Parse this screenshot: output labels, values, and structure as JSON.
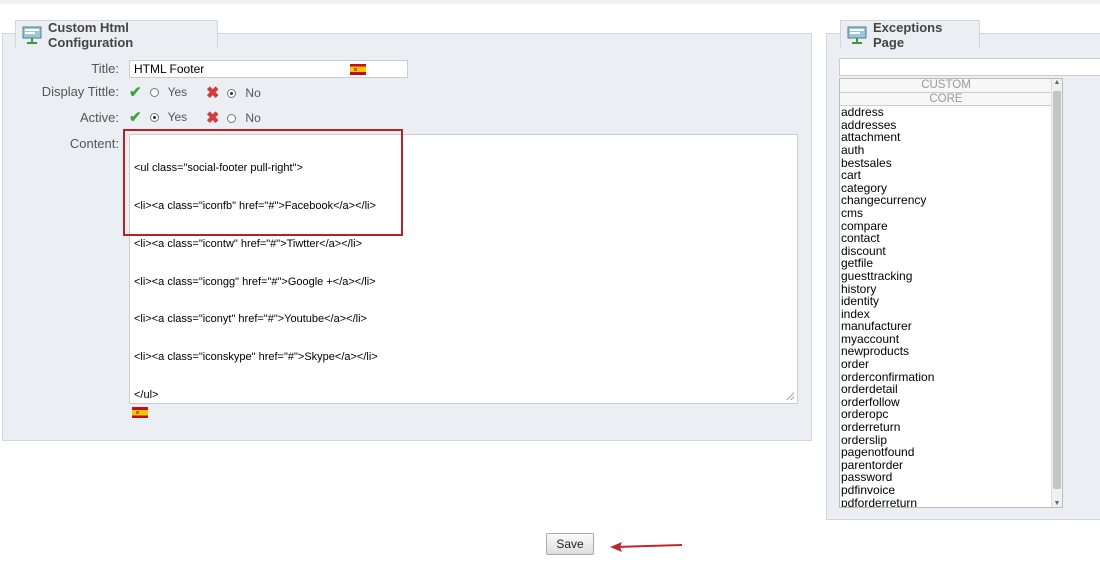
{
  "left_panel": {
    "legend": "Custom Html Configuration",
    "title_label": "Title:",
    "title_value": "HTML Footer",
    "display_title_label": "Display Tittle:",
    "display_title_yes": "Yes",
    "display_title_no": "No",
    "display_title_selected": "No",
    "active_label": "Active:",
    "active_yes": "Yes",
    "active_no": "No",
    "active_selected": "Yes",
    "content_label": "Content:",
    "content_lines": [
      "<ul class=\"social-footer pull-right\">",
      "<li><a class=\"iconfb\" href=\"#\">Facebook</a></li>",
      "<li><a class=\"icontw\" href=\"#\">Tiwtter</a></li>",
      "<li><a class=\"icongg\" href=\"#\">Google +</a></li>",
      "<li><a class=\"iconyt\" href=\"#\">Youtube</a></li>",
      "<li><a class=\"iconskype\" href=\"#\">Skype</a></li>",
      "</ul>"
    ]
  },
  "right_panel": {
    "legend": "Exceptions Page",
    "groups": [
      "CUSTOM",
      "CORE"
    ],
    "items": [
      "address",
      "addresses",
      "attachment",
      "auth",
      "bestsales",
      "cart",
      "category",
      "changecurrency",
      "cms",
      "compare",
      "contact",
      "discount",
      "getfile",
      "guesttracking",
      "history",
      "identity",
      "index",
      "manufacturer",
      "myaccount",
      "newproducts",
      "order",
      "orderconfirmation",
      "orderdetail",
      "orderfollow",
      "orderopc",
      "orderreturn",
      "orderslip",
      "pagenotfound",
      "parentorder",
      "password",
      "pdfinvoice",
      "pdforderreturn"
    ]
  },
  "save_label": "Save",
  "colors": {
    "highlight_box": "#b0232a",
    "annotation_arrow": "#c0272d"
  },
  "icons": {
    "legend": "settings-panel-icon",
    "flag": "spain-flag-icon",
    "check": "check-icon",
    "cross": "cross-icon"
  }
}
